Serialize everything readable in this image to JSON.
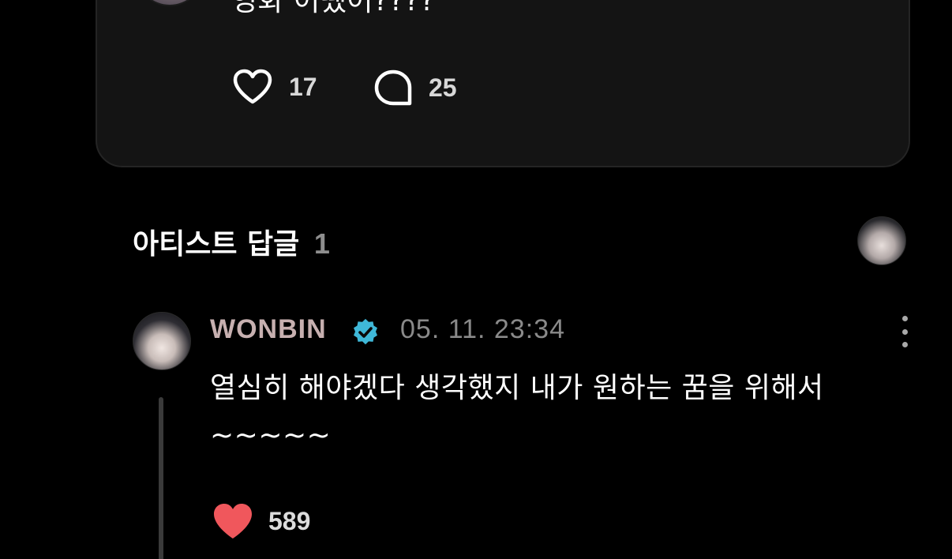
{
  "post": {
    "text": "영화 어땠어????",
    "likes": "17",
    "comments": "25"
  },
  "replies_section": {
    "title": "아티스트 답글",
    "count": "1"
  },
  "artist_comment": {
    "name": "WONBIN",
    "timestamp": "05. 11. 23:34",
    "body": "열심히 해야겠다 생각했지 내가 원하는 꿈을 위해서\n~~~~~",
    "likes": "589",
    "liked": true
  },
  "colors": {
    "background": "#000000",
    "card": "#141414",
    "like_red": "#f0575c",
    "verified_blue": "#3fb8d8",
    "artist_name": "#c7b0b0"
  },
  "icons": {
    "like": "heart-outline-icon",
    "comment": "speech-bubble-icon",
    "verified": "verified-badge-icon",
    "more": "more-vertical-icon",
    "liked": "heart-filled-icon"
  }
}
